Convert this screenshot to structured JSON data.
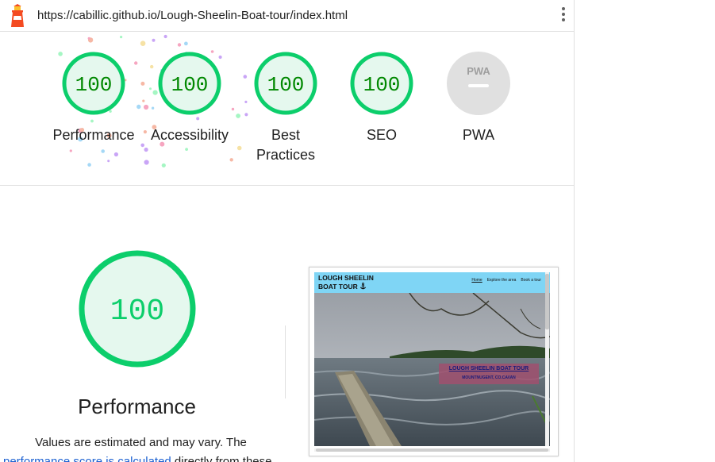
{
  "browser": {
    "url": "https://cabillic.github.io/Lough-Sheelin-Boat-tour/index.html",
    "logo_icon": "lighthouse-icon",
    "menu_icon": "more-vertical-icon"
  },
  "gauges": [
    {
      "label": "Performance",
      "score": 100,
      "score_text": "100"
    },
    {
      "label": "Accessibility",
      "score": 100,
      "score_text": "100"
    },
    {
      "label": "Best Practices",
      "score": 100,
      "score_text": "100"
    },
    {
      "label": "SEO",
      "score": 100,
      "score_text": "100"
    },
    {
      "label": "PWA",
      "score_text": "PWA",
      "status": "not-applicable"
    }
  ],
  "performance": {
    "score": 100,
    "score_text": "100",
    "title": "Performance",
    "note_line1": "Values are estimated and may vary. The",
    "note_link": "performance score is calculated",
    "note_line2_suffix": " directly from these"
  },
  "screenshot": {
    "brand_line1": "LOUGH SHEELIN",
    "brand_line2": "BOAT TOUR",
    "brand_icon": "anchor-icon",
    "nav_links": [
      "Home",
      "Explore the area",
      "Book a tour"
    ],
    "hero_title": "LOUGH SHEELIN BOAT TOUR",
    "hero_subtitle": "MOUNTNUGENT, CO.CAVAN"
  },
  "colors": {
    "pass": "#0cce6b",
    "pass_text": "#008800",
    "pass_fill": "#e5f8ee",
    "na": "#e0e0e0",
    "link": "#1a5fd1",
    "nav_bg": "#7fd5f5"
  }
}
